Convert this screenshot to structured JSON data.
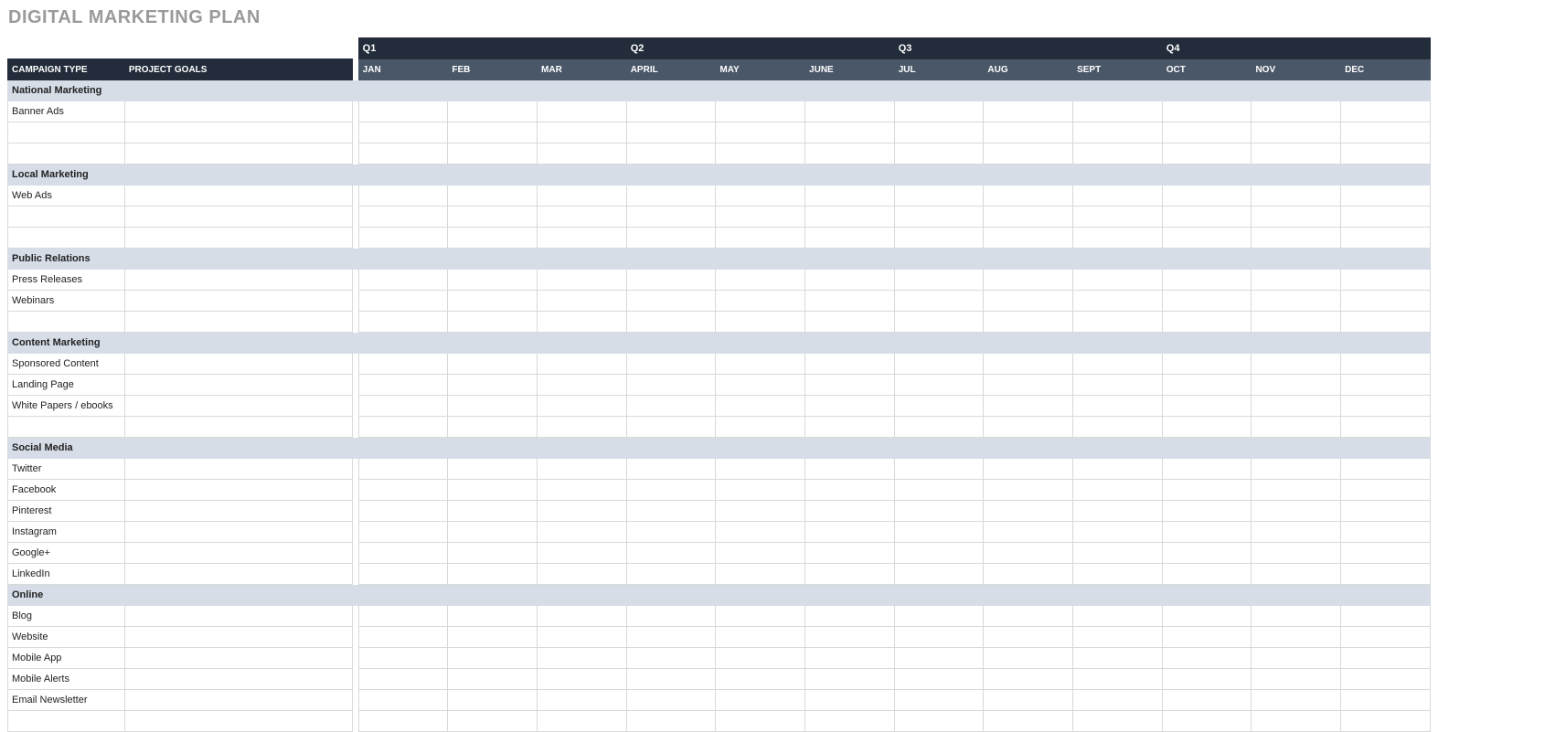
{
  "title": "DIGITAL MARKETING PLAN",
  "headers": {
    "campaign_type": "CAMPAIGN TYPE",
    "project_goals": "PROJECT GOALS"
  },
  "quarters": [
    "Q1",
    "Q2",
    "Q3",
    "Q4"
  ],
  "months": [
    "JAN",
    "FEB",
    "MAR",
    "APRIL",
    "MAY",
    "JUNE",
    "JUL",
    "AUG",
    "SEPT",
    "OCT",
    "NOV",
    "DEC"
  ],
  "sections": [
    {
      "name": "National Marketing",
      "rows": [
        {
          "type": "Banner Ads",
          "goals": ""
        },
        {
          "type": "",
          "goals": ""
        },
        {
          "type": "",
          "goals": ""
        }
      ]
    },
    {
      "name": "Local Marketing",
      "rows": [
        {
          "type": "Web Ads",
          "goals": ""
        },
        {
          "type": "",
          "goals": ""
        },
        {
          "type": "",
          "goals": ""
        }
      ]
    },
    {
      "name": "Public Relations",
      "rows": [
        {
          "type": "Press Releases",
          "goals": ""
        },
        {
          "type": "Webinars",
          "goals": ""
        },
        {
          "type": "",
          "goals": ""
        }
      ]
    },
    {
      "name": "Content Marketing",
      "rows": [
        {
          "type": "Sponsored Content",
          "goals": ""
        },
        {
          "type": "Landing Page",
          "goals": ""
        },
        {
          "type": "White Papers / ebooks",
          "goals": ""
        },
        {
          "type": "",
          "goals": ""
        }
      ]
    },
    {
      "name": "Social Media",
      "rows": [
        {
          "type": "Twitter",
          "goals": ""
        },
        {
          "type": "Facebook",
          "goals": ""
        },
        {
          "type": "Pinterest",
          "goals": ""
        },
        {
          "type": "Instagram",
          "goals": ""
        },
        {
          "type": "Google+",
          "goals": ""
        },
        {
          "type": "LinkedIn",
          "goals": ""
        }
      ]
    },
    {
      "name": "Online",
      "rows": [
        {
          "type": "Blog",
          "goals": ""
        },
        {
          "type": "Website",
          "goals": ""
        },
        {
          "type": "Mobile App",
          "goals": ""
        },
        {
          "type": "Mobile Alerts",
          "goals": ""
        },
        {
          "type": "Email Newsletter",
          "goals": ""
        },
        {
          "type": "",
          "goals": ""
        }
      ]
    }
  ]
}
